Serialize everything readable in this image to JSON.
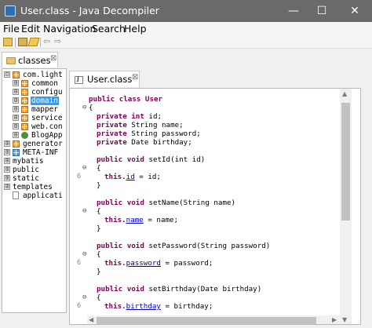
{
  "window": {
    "title": "User.class - Java Decompiler",
    "minimize": "—",
    "maximize": "☐",
    "close": "✕"
  },
  "menu": [
    "File",
    "Edit",
    "Navigation",
    "Search",
    "Help"
  ],
  "toolbar": {
    "icons": [
      "open-file-icon",
      "open-type-icon",
      "edit-icon",
      "back-icon",
      "forward-icon"
    ]
  },
  "left_tab": {
    "label": "classes",
    "close": "⊠"
  },
  "tree": [
    {
      "label": "com.light",
      "expander": "⊟"
    },
    {
      "label": "common",
      "expander": "⊞"
    },
    {
      "label": "configu",
      "expander": "⊞"
    },
    {
      "label": "domain",
      "expander": "⊞",
      "selected": true
    },
    {
      "label": "mapper",
      "expander": "⊞"
    },
    {
      "label": "service",
      "expander": "⊞"
    },
    {
      "label": "web.con",
      "expander": "⊞"
    },
    {
      "label": "BlogApp",
      "expander": "⊞"
    },
    {
      "label": "generator",
      "expander": "⊞"
    },
    {
      "label": "META-INF",
      "expander": "⊞"
    },
    {
      "label": "mybatis",
      "expander": "⊞"
    },
    {
      "label": "public",
      "expander": "⊞"
    },
    {
      "label": "static",
      "expander": "⊞"
    },
    {
      "label": "templates",
      "expander": "⊞"
    },
    {
      "label": "applicati",
      "expander": ""
    }
  ],
  "editor_tab": {
    "label": "User.class",
    "close": "⊠"
  },
  "code": {
    "l1": "public class User",
    "l2": "{",
    "l3a": "private int",
    "l3b": "id;",
    "l4a": "private",
    "l4b": "String name;",
    "l5a": "private",
    "l5b": "String password;",
    "l6a": "private",
    "l6b": "Date birthday;",
    "m1a": "public void",
    "m1b": "setId(int id)",
    "m1c": "this.",
    "m1d": "id",
    "m1e": " = id;",
    "m2a": "public void",
    "m2b": "setName(String name)",
    "m2c": "this.",
    "m2d": "name",
    "m2e": " = name;",
    "m3a": "public void",
    "m3b": "setPassword(String password)",
    "m3c": "this.",
    "m3d": "password",
    "m3e": " = password;",
    "m4a": "public void",
    "m4b": "setBirthday(Date birthday)",
    "m4c": "this.",
    "m4d": "birthday",
    "m4e": " = birthday;",
    "open": "{",
    "closeb": "}",
    "lineno": "6",
    "fold": "⊖"
  }
}
